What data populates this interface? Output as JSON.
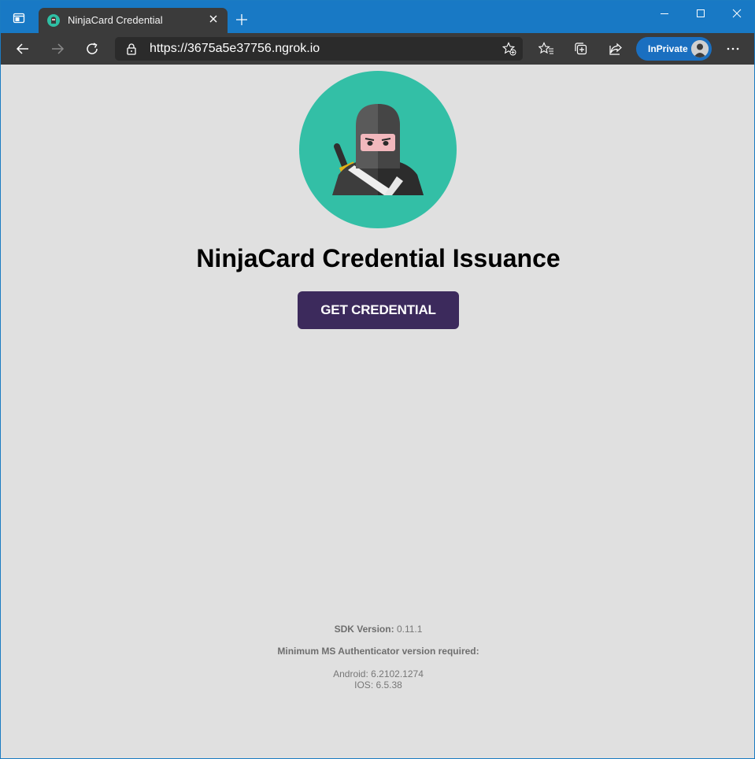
{
  "browser": {
    "tab_title": "NinjaCard Credential",
    "url_scheme": "https://",
    "url_rest": "3675a5e37756.ngrok.io",
    "inprivate_label": "InPrivate"
  },
  "page": {
    "title": "NinjaCard Credential Issuance",
    "button_label": "GET CREDENTIAL",
    "sdk_label": "SDK Version:",
    "sdk_value": "0.11.1",
    "min_label": "Minimum MS Authenticator version required:",
    "android": "Android: 6.2102.1274",
    "ios": "IOS: 6.5.38"
  },
  "colors": {
    "titlebar": "#1879c5",
    "toolbar": "#3b3b3b",
    "page_bg": "#e0e0e0",
    "button": "#3c2a5c",
    "logo_circle": "#33bfa6"
  },
  "icons": [
    "tab-actions-icon",
    "ninja-favicon-icon",
    "close-icon",
    "plus-icon",
    "minimize-icon",
    "maximize-icon",
    "window-close-icon",
    "back-icon",
    "forward-icon",
    "refresh-icon",
    "lock-icon",
    "favorite-add-icon",
    "favorites-icon",
    "collections-icon",
    "share-icon",
    "avatar-icon",
    "more-icon",
    "ninja-logo-icon"
  ]
}
